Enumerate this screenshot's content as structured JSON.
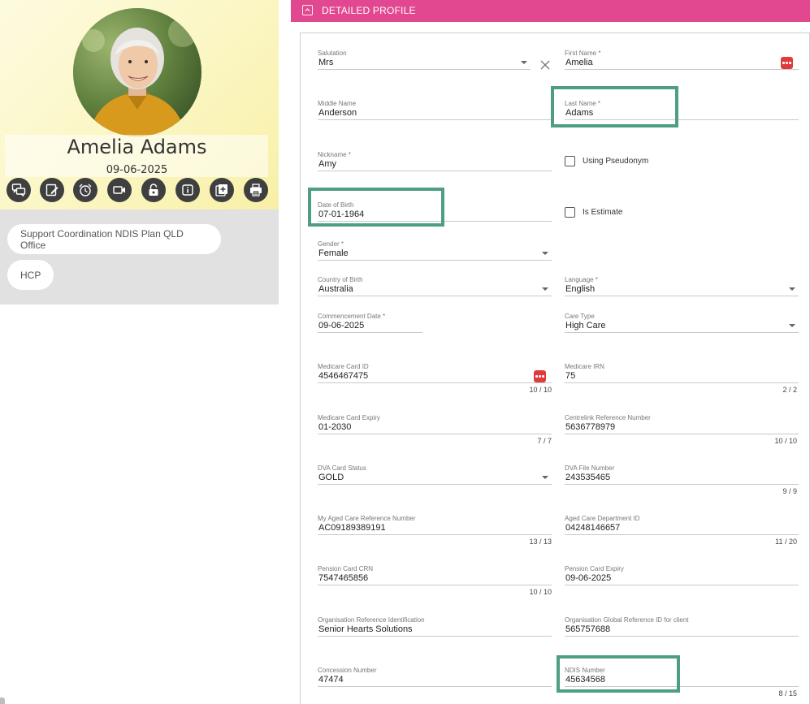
{
  "client": {
    "name": "Amelia Adams",
    "date": "09-06-2025",
    "actions": [
      "chat-icon",
      "edit-note-icon",
      "alarm-clock-icon",
      "video-call-icon",
      "unlock-icon",
      "info-icon",
      "add-note-icon",
      "print-icon"
    ],
    "tags": [
      "Support Coordination NDIS Plan QLD Office",
      "HCP"
    ]
  },
  "section": {
    "title": "DETAILED PROFILE"
  },
  "form": {
    "salutation": {
      "label": "Salutation",
      "value": "Mrs"
    },
    "first_name": {
      "label": "First Name *",
      "value": "Amelia"
    },
    "middle_name": {
      "label": "Middle Name",
      "value": "Anderson"
    },
    "last_name": {
      "label": "Last Name *",
      "value": "Adams"
    },
    "nickname": {
      "label": "Nickname *",
      "value": "Amy"
    },
    "using_pseudonym": {
      "label": "Using Pseudonym",
      "checked": false
    },
    "date_of_birth": {
      "label": "Date of Birth",
      "value": "07-01-1964"
    },
    "is_estimate": {
      "label": "Is Estimate",
      "checked": false
    },
    "gender": {
      "label": "Gender *",
      "value": "Female"
    },
    "country_of_birth": {
      "label": "Country of Birth",
      "value": "Australia"
    },
    "language": {
      "label": "Language *",
      "value": "English"
    },
    "commencement_date": {
      "label": "Commencement Date *",
      "value": "09-06-2025"
    },
    "care_type": {
      "label": "Care Type",
      "value": "High Care"
    },
    "medicare_card_id": {
      "label": "Medicare Card ID",
      "value": "4546467475",
      "counter": "10 / 10"
    },
    "medicare_irn": {
      "label": "Medicare IRN",
      "value": "75",
      "counter": "2 / 2"
    },
    "medicare_card_expiry": {
      "label": "Medicare Card Expiry",
      "value": "01-2030",
      "counter": "7 / 7"
    },
    "centrelink_reference_number": {
      "label": "Centrelink Reference Number",
      "value": "5636778979",
      "counter": "10 / 10"
    },
    "dva_card_status": {
      "label": "DVA Card Status",
      "value": "GOLD"
    },
    "dva_file_number": {
      "label": "DVA File Number",
      "value": "243535465",
      "counter": "9 / 9"
    },
    "my_aged_care_reference": {
      "label": "My Aged Care Reference Number",
      "value": "AC09189389191",
      "counter": "13 / 13"
    },
    "aged_care_department_id": {
      "label": "Aged Care Department ID",
      "value": "04248146657",
      "counter": "11 / 20"
    },
    "pension_card_crn": {
      "label": "Pension Card CRN",
      "value": "7547465856",
      "counter": "10 / 10"
    },
    "pension_card_expiry": {
      "label": "Pension Card Expiry",
      "value": "09-06-2025"
    },
    "organisation_reference_identification": {
      "label": "Organisation Reference Identification",
      "value": "Senior Hearts Solutions"
    },
    "organisation_global_reference_id": {
      "label": "Organisation Global Reference ID for client",
      "value": "565757688"
    },
    "concession_number": {
      "label": "Concession Number",
      "value": "47474"
    },
    "ndis_number": {
      "label": "NDIS Number",
      "value": "45634568",
      "counter": "8 / 15"
    }
  },
  "colors": {
    "header": "#e2488f",
    "highlight": "#4e9e85",
    "dots_button": "#e03b3b",
    "icon_button": "#3f3f3f"
  }
}
